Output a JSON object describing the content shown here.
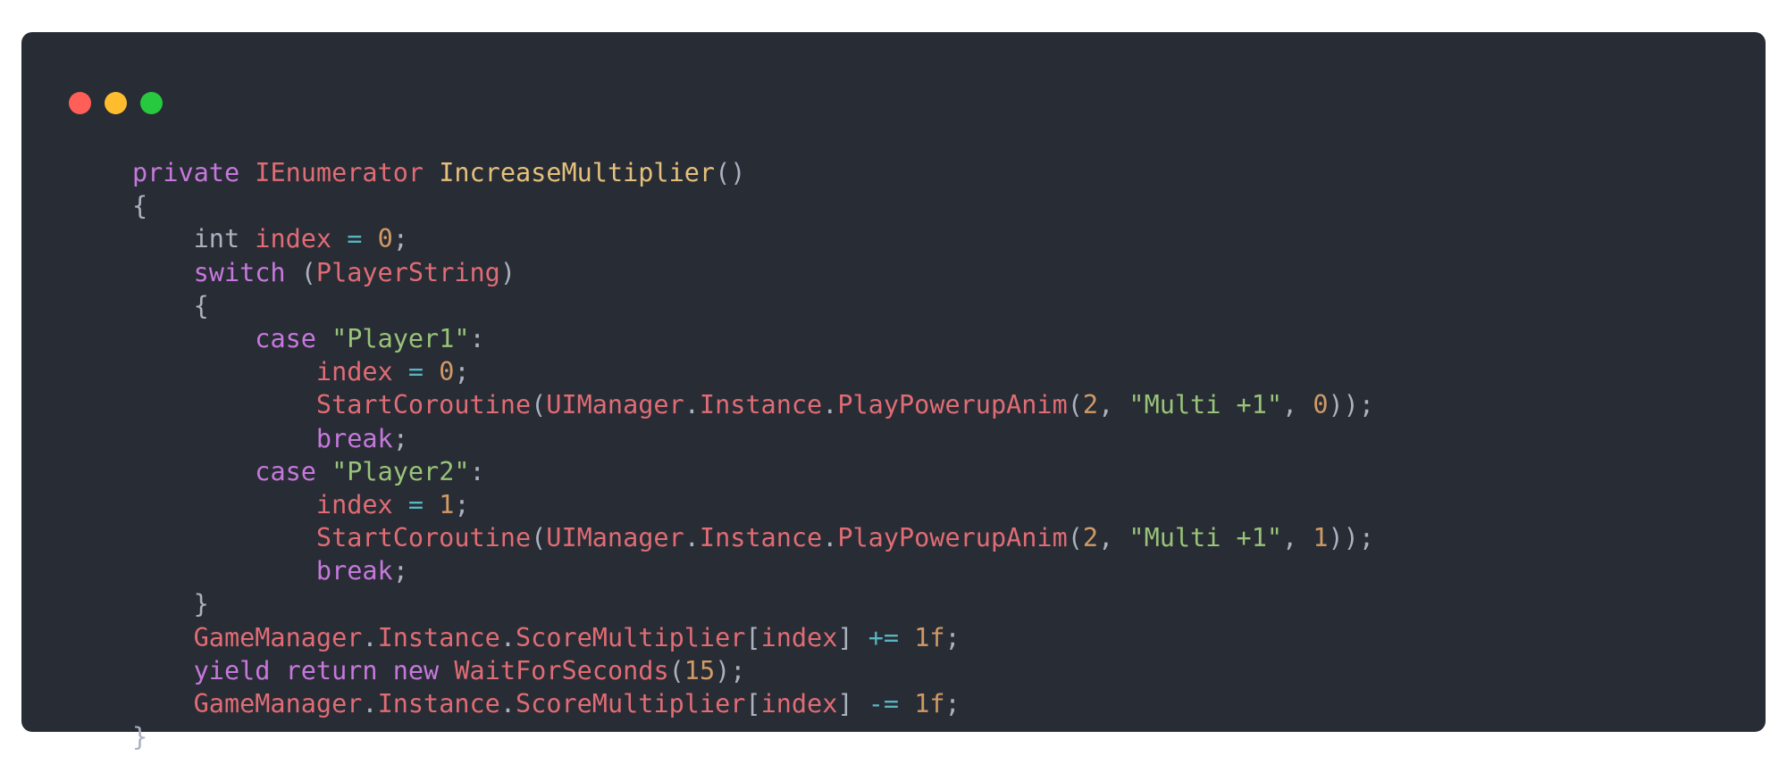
{
  "window": {
    "traffic_lights": [
      {
        "name": "close",
        "color": "#ff5f56"
      },
      {
        "name": "minimize",
        "color": "#ffbd2e"
      },
      {
        "name": "maximize",
        "color": "#27c93f"
      }
    ]
  },
  "colors": {
    "background": "#282c34",
    "keyword": "#c678dd",
    "type": "#e06c75",
    "function": "#e5c07b",
    "plain": "#abb2bf",
    "variable": "#e06c75",
    "operator": "#56b6c2",
    "number": "#d19a66",
    "string": "#98c379"
  },
  "code": {
    "language": "csharp",
    "lines": [
      [
        [
          "kw",
          "private"
        ],
        [
          "pl",
          " "
        ],
        [
          "ty",
          "IEnumerator"
        ],
        [
          "pl",
          " "
        ],
        [
          "fn",
          "IncreaseMultiplier"
        ],
        [
          "pl",
          "()"
        ]
      ],
      [
        [
          "pl",
          "{"
        ]
      ],
      [
        [
          "pl",
          "    int "
        ],
        [
          "vr",
          "index"
        ],
        [
          "pl",
          " "
        ],
        [
          "op",
          "="
        ],
        [
          "pl",
          " "
        ],
        [
          "nm",
          "0"
        ],
        [
          "pl",
          ";"
        ]
      ],
      [
        [
          "pl",
          "    "
        ],
        [
          "kw",
          "switch"
        ],
        [
          "pl",
          " ("
        ],
        [
          "vr",
          "PlayerString"
        ],
        [
          "pl",
          ")"
        ]
      ],
      [
        [
          "pl",
          "    {"
        ]
      ],
      [
        [
          "pl",
          "        "
        ],
        [
          "kw",
          "case"
        ],
        [
          "pl",
          " "
        ],
        [
          "st",
          "\"Player1\""
        ],
        [
          "pl",
          ":"
        ]
      ],
      [
        [
          "pl",
          "            "
        ],
        [
          "vr",
          "index"
        ],
        [
          "pl",
          " "
        ],
        [
          "op",
          "="
        ],
        [
          "pl",
          " "
        ],
        [
          "nm",
          "0"
        ],
        [
          "pl",
          ";"
        ]
      ],
      [
        [
          "pl",
          "            "
        ],
        [
          "vr",
          "StartCoroutine"
        ],
        [
          "pl",
          "("
        ],
        [
          "vr",
          "UIManager"
        ],
        [
          "pl",
          "."
        ],
        [
          "vr",
          "Instance"
        ],
        [
          "pl",
          "."
        ],
        [
          "vr",
          "PlayPowerupAnim"
        ],
        [
          "pl",
          "("
        ],
        [
          "nm",
          "2"
        ],
        [
          "pl",
          ", "
        ],
        [
          "st",
          "\"Multi +1\""
        ],
        [
          "pl",
          ", "
        ],
        [
          "nm",
          "0"
        ],
        [
          "pl",
          "));"
        ]
      ],
      [
        [
          "pl",
          "            "
        ],
        [
          "kw",
          "break"
        ],
        [
          "pl",
          ";"
        ]
      ],
      [
        [
          "pl",
          "        "
        ],
        [
          "kw",
          "case"
        ],
        [
          "pl",
          " "
        ],
        [
          "st",
          "\"Player2\""
        ],
        [
          "pl",
          ":"
        ]
      ],
      [
        [
          "pl",
          "            "
        ],
        [
          "vr",
          "index"
        ],
        [
          "pl",
          " "
        ],
        [
          "op",
          "="
        ],
        [
          "pl",
          " "
        ],
        [
          "nm",
          "1"
        ],
        [
          "pl",
          ";"
        ]
      ],
      [
        [
          "pl",
          "            "
        ],
        [
          "vr",
          "StartCoroutine"
        ],
        [
          "pl",
          "("
        ],
        [
          "vr",
          "UIManager"
        ],
        [
          "pl",
          "."
        ],
        [
          "vr",
          "Instance"
        ],
        [
          "pl",
          "."
        ],
        [
          "vr",
          "PlayPowerupAnim"
        ],
        [
          "pl",
          "("
        ],
        [
          "nm",
          "2"
        ],
        [
          "pl",
          ", "
        ],
        [
          "st",
          "\"Multi +1\""
        ],
        [
          "pl",
          ", "
        ],
        [
          "nm",
          "1"
        ],
        [
          "pl",
          "));"
        ]
      ],
      [
        [
          "pl",
          "            "
        ],
        [
          "kw",
          "break"
        ],
        [
          "pl",
          ";"
        ]
      ],
      [
        [
          "pl",
          "    }"
        ]
      ],
      [
        [
          "pl",
          "    "
        ],
        [
          "vr",
          "GameManager"
        ],
        [
          "pl",
          "."
        ],
        [
          "vr",
          "Instance"
        ],
        [
          "pl",
          "."
        ],
        [
          "vr",
          "ScoreMultiplier"
        ],
        [
          "pl",
          "["
        ],
        [
          "vr",
          "index"
        ],
        [
          "pl",
          "] "
        ],
        [
          "op",
          "+="
        ],
        [
          "pl",
          " "
        ],
        [
          "nm",
          "1f"
        ],
        [
          "pl",
          ";"
        ]
      ],
      [
        [
          "pl",
          "    "
        ],
        [
          "kw",
          "yield"
        ],
        [
          "pl",
          " "
        ],
        [
          "kw",
          "return"
        ],
        [
          "pl",
          " "
        ],
        [
          "kw",
          "new"
        ],
        [
          "pl",
          " "
        ],
        [
          "vr",
          "WaitForSeconds"
        ],
        [
          "pl",
          "("
        ],
        [
          "nm",
          "15"
        ],
        [
          "pl",
          ");"
        ]
      ],
      [
        [
          "pl",
          "    "
        ],
        [
          "vr",
          "GameManager"
        ],
        [
          "pl",
          "."
        ],
        [
          "vr",
          "Instance"
        ],
        [
          "pl",
          "."
        ],
        [
          "vr",
          "ScoreMultiplier"
        ],
        [
          "pl",
          "["
        ],
        [
          "vr",
          "index"
        ],
        [
          "pl",
          "] "
        ],
        [
          "op",
          "-="
        ],
        [
          "pl",
          " "
        ],
        [
          "nm",
          "1f"
        ],
        [
          "pl",
          ";"
        ]
      ],
      [
        [
          "pl",
          "}"
        ]
      ]
    ]
  }
}
